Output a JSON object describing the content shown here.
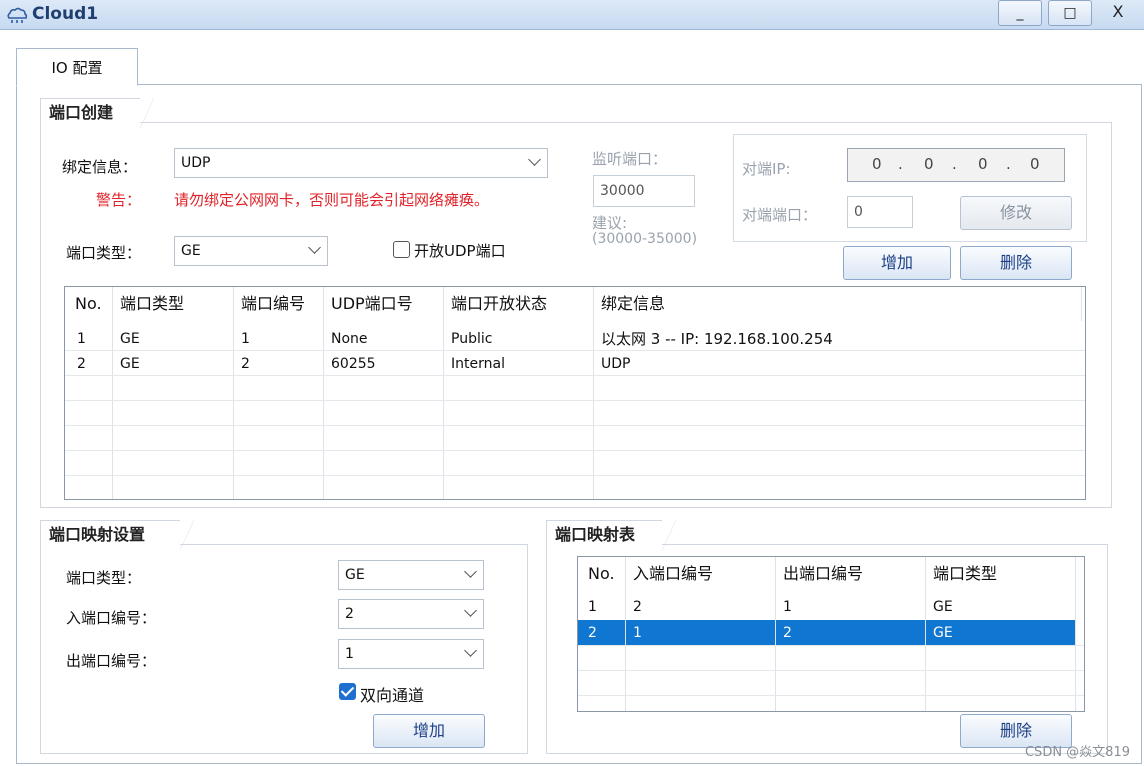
{
  "window": {
    "title": "Cloud1",
    "minimize": "_",
    "maximize": "□",
    "close": "X"
  },
  "tabs": {
    "io": "IO 配置"
  },
  "port_create": {
    "title": "端口创建",
    "bind_label": "绑定信息：",
    "bind_value": "UDP",
    "warning_label": "警告：",
    "warning_text": "请勿绑定公网网卡，否则可能会引起网络瘫痪。",
    "port_type_label": "端口类型：",
    "port_type_value": "GE",
    "open_udp_label": "开放UDP端口",
    "listen_port_label": "监听端口：",
    "listen_port_value": "30000",
    "suggest_label": "建议:",
    "suggest_range": "(30000-35000)",
    "peer_ip_label": "对端IP:",
    "peer_ip": [
      "0",
      "0",
      "0",
      "0"
    ],
    "peer_port_label": "对端端口：",
    "peer_port_value": "0",
    "modify_button": "修改",
    "add_button": "增加",
    "delete_button": "删除",
    "table": {
      "headers": [
        "No.",
        "端口类型",
        "端口编号",
        "UDP端口号",
        "端口开放状态",
        "绑定信息"
      ],
      "rows": [
        [
          "1",
          "GE",
          "1",
          "None",
          "Public",
          "以太网 3 -- IP: 192.168.100.254"
        ],
        [
          "2",
          "GE",
          "2",
          "60255",
          "Internal",
          "UDP"
        ]
      ]
    }
  },
  "mapping_settings": {
    "title": "端口映射设置",
    "port_type_label": "端口类型：",
    "port_type_value": "GE",
    "in_port_label": "入端口编号：",
    "in_port_value": "2",
    "out_port_label": "出端口编号：",
    "out_port_value": "1",
    "bidirectional_label": "双向通道",
    "add_button": "增加"
  },
  "mapping_table": {
    "title": "端口映射表",
    "headers": [
      "No.",
      "入端口编号",
      "出端口编号",
      "端口类型"
    ],
    "rows": [
      [
        "1",
        "2",
        "1",
        "GE"
      ],
      [
        "2",
        "1",
        "2",
        "GE"
      ]
    ],
    "selected_row": 2,
    "delete_button": "删除"
  },
  "watermark": "CSDN @焱文819",
  "colors": {
    "selection": "#0f76d2",
    "warning": "#e0232a",
    "button_text": "#1c3f86"
  }
}
